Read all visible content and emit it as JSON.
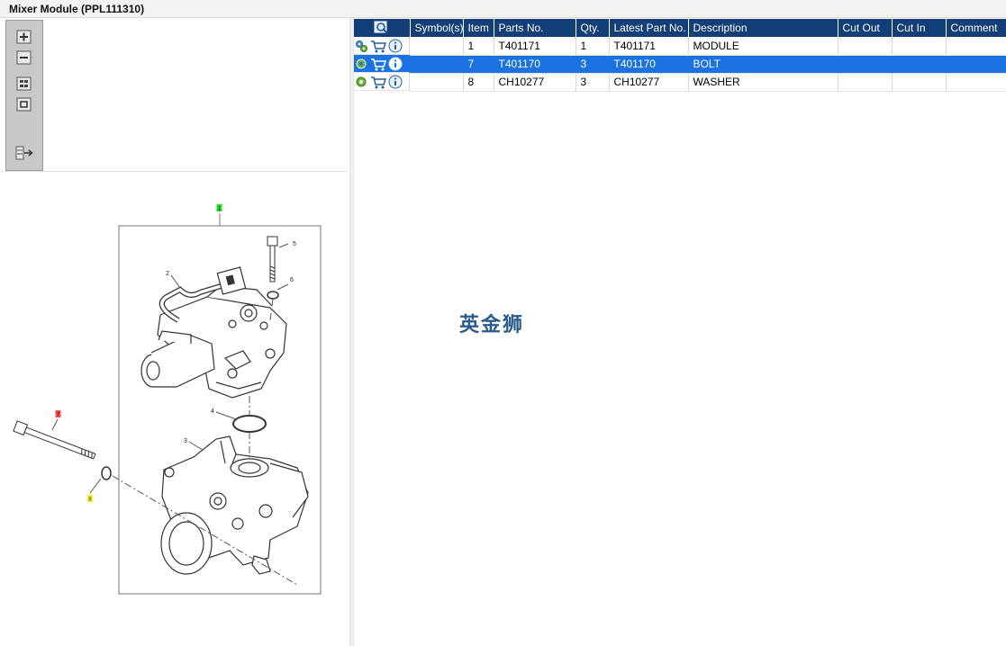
{
  "window": {
    "title": "Mixer Module (PPL111310)"
  },
  "toolbar": {
    "buttons": [
      {
        "icon": "zoom-in-icon"
      },
      {
        "icon": "zoom-out-icon"
      },
      {
        "icon": "fit-page-icon"
      },
      {
        "icon": "actual-size-icon"
      },
      {
        "icon": "export-icon"
      }
    ]
  },
  "drawing": {
    "callouts": [
      "1",
      "2",
      "3",
      "4",
      "5",
      "6",
      "7",
      "8"
    ]
  },
  "table": {
    "columns": [
      "Symbol(s)",
      "Item",
      "Parts No.",
      "Qty.",
      "Latest Part No.",
      "Description",
      "Cut Out",
      "Cut In",
      "Comment"
    ],
    "rows": [
      {
        "item": "1",
        "parts_no": "T401171",
        "qty": "1",
        "latest_part_no": "T401171",
        "description": "MODULE",
        "symbols": "",
        "cut_out": "",
        "cut_in": "",
        "comment": ""
      },
      {
        "item": "7",
        "parts_no": "T401170",
        "qty": "3",
        "latest_part_no": "T401170",
        "description": "BOLT",
        "symbols": "",
        "cut_out": "",
        "cut_in": "",
        "comment": ""
      },
      {
        "item": "8",
        "parts_no": "CH10277",
        "qty": "3",
        "latest_part_no": "CH10277",
        "description": "WASHER",
        "symbols": "",
        "cut_out": "",
        "cut_in": "",
        "comment": ""
      }
    ],
    "selected_row": 1
  },
  "watermark": "英金狮",
  "colors": {
    "header": "#123f78",
    "selection": "#1a73e0"
  }
}
